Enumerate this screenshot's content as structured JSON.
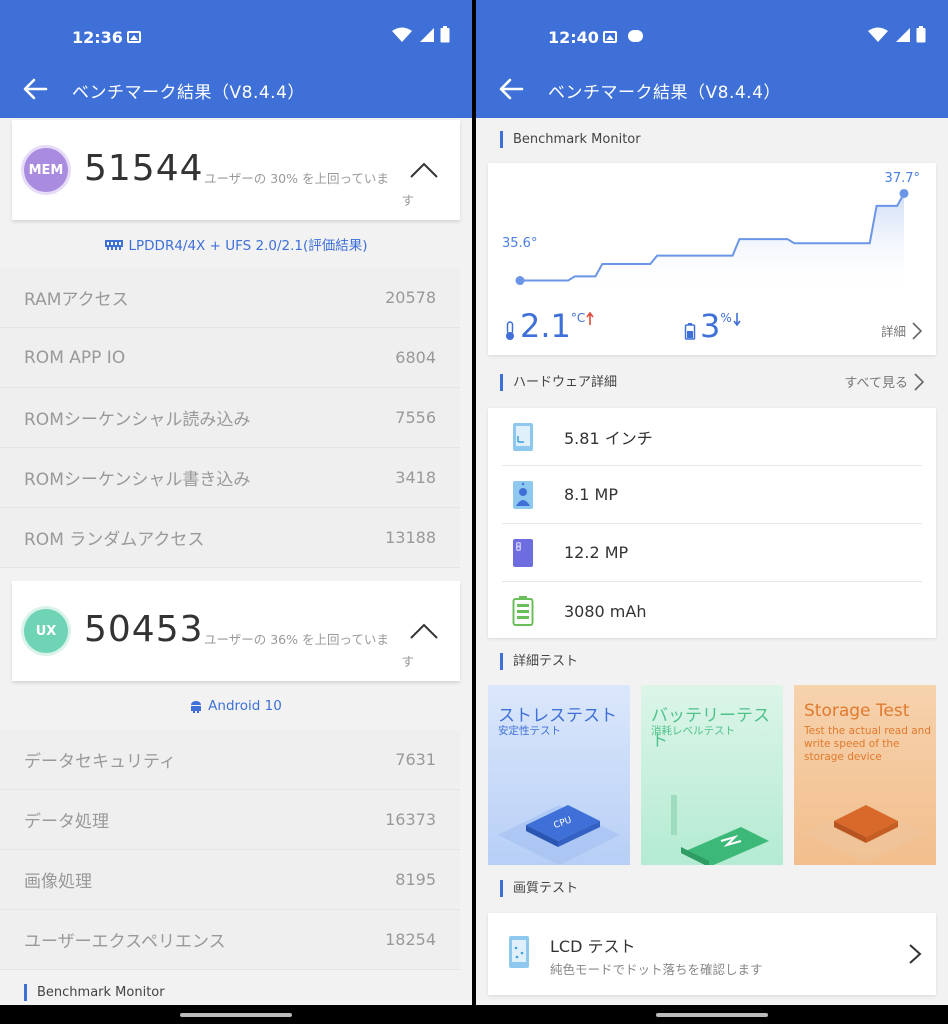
{
  "left": {
    "status": {
      "time": "12:36"
    },
    "title": "ベンチマーク結果（V8.4.4）",
    "mem": {
      "badge": "MEM",
      "score": "51544",
      "note": "ユーザーの 30% を上回っていま",
      "note_end": "す",
      "sub_label": "LPDDR4/4X + UFS 2.0/2.1(評価結果)",
      "rows": [
        {
          "label": "RAMアクセス",
          "value": "20578"
        },
        {
          "label": "ROM APP IO",
          "value": "6804"
        },
        {
          "label": "ROMシーケンシャル読み込み",
          "value": "7556"
        },
        {
          "label": "ROMシーケンシャル書き込み",
          "value": "3418"
        },
        {
          "label": "ROM ランダムアクセス",
          "value": "13188"
        }
      ]
    },
    "ux": {
      "badge": "UX",
      "score": "50453",
      "note": "ユーザーの 36% を上回っていま",
      "note_end": "す",
      "sub_label": "Android 10",
      "rows": [
        {
          "label": "データセキュリティ",
          "value": "7631"
        },
        {
          "label": "データ処理",
          "value": "16373"
        },
        {
          "label": "画像処理",
          "value": "8195"
        },
        {
          "label": "ユーザーエクスペリエンス",
          "value": "18254"
        }
      ]
    },
    "bottom_section": "Benchmark Monitor"
  },
  "right": {
    "status": {
      "time": "12:40"
    },
    "title": "ベンチマーク結果（V8.4.4）",
    "monitor": {
      "heading": "Benchmark Monitor",
      "temp_start": "35.6°",
      "temp_end": "37.7°",
      "temp_delta": "2.1",
      "temp_unit": "°C",
      "battery_delta": "3",
      "battery_unit": "%",
      "detail": "詳細"
    },
    "hardware": {
      "heading": "ハードウェア詳細",
      "see_all": "すべて見る",
      "items": [
        {
          "text": "5.81 インチ",
          "icon": "screen-icon"
        },
        {
          "text": "8.1 MP",
          "icon": "front-camera-icon"
        },
        {
          "text": "12.2 MP",
          "icon": "rear-camera-icon"
        },
        {
          "text": "3080 mAh",
          "icon": "battery-icon"
        }
      ]
    },
    "tests": {
      "heading": "詳細テスト",
      "tiles": [
        {
          "title": "ストレステスト",
          "sub": "安定性テスト"
        },
        {
          "title": "バッテリーテスト",
          "sub": "消耗レベルテスト"
        },
        {
          "title": "Storage Test",
          "sub": "Test the actual read and write speed of the storage device"
        }
      ]
    },
    "display": {
      "heading": "画質テスト",
      "lcd_title": "LCD テスト",
      "lcd_sub": "純色モードでドット落ちを確認します"
    }
  },
  "colors": {
    "appbar": "#3e70d8",
    "mem_badge": "#a98be0",
    "ux_badge": "#6fd3b5",
    "accent": "#3e70d8"
  },
  "chart_data": {
    "type": "line",
    "title": "",
    "xlabel": "",
    "ylabel": "",
    "series": [
      {
        "values": [
          35.6,
          35.6,
          35.7,
          36.0,
          36.0,
          36.2,
          36.2,
          36.2,
          36.6,
          36.6,
          36.5,
          36.5,
          36.5,
          37.4,
          37.7
        ]
      }
    ],
    "ylim": [
      35.3,
      38.0
    ]
  }
}
